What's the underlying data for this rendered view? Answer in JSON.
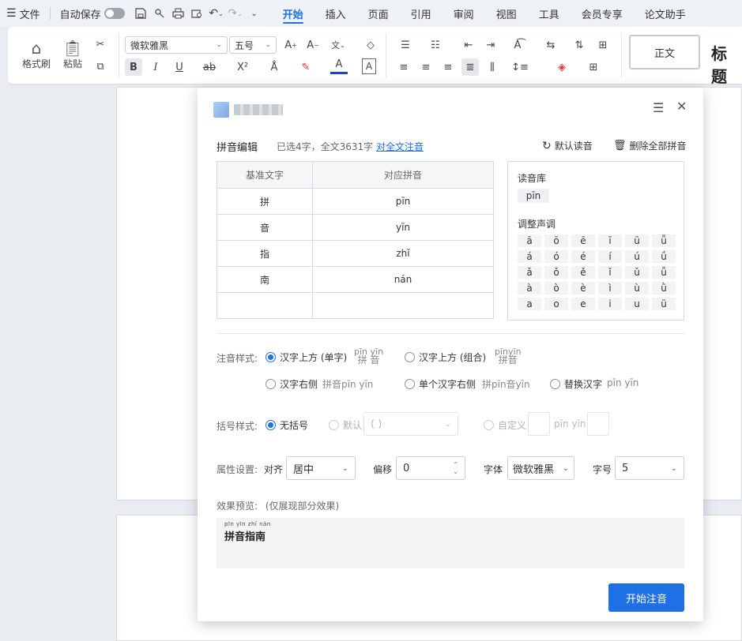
{
  "menubar": {
    "file_label": "文件",
    "autosave_label": "自动保存",
    "tabs": [
      "开始",
      "插入",
      "页面",
      "引用",
      "审阅",
      "视图",
      "工具",
      "会员专享",
      "论文助手"
    ]
  },
  "ribbon": {
    "format_painter": "格式刷",
    "paste": "粘贴",
    "font_name": "微软雅黑",
    "font_size": "五号",
    "bold": "B",
    "italic": "I",
    "underline": "U",
    "strike": "ab",
    "superscript": "X²",
    "font_color": "A",
    "char_border": "A",
    "style_normal": "正文",
    "style_title": "标题"
  },
  "dialog": {
    "section_title": "拼音编辑",
    "selection_info": "已选4字，全文3631字",
    "full_text_link": "对全文注音",
    "default_reading": "默认读音",
    "delete_all": "删除全部拼音",
    "table": {
      "headers": [
        "基准文字",
        "对应拼音"
      ],
      "rows": [
        {
          "char": "拼",
          "pinyin": "pīn"
        },
        {
          "char": "音",
          "pinyin": "yīn"
        },
        {
          "char": "指",
          "pinyin": "zhǐ"
        },
        {
          "char": "南",
          "pinyin": "nán"
        },
        {
          "char": "",
          "pinyin": ""
        }
      ]
    },
    "reading_lib": {
      "title": "读音库",
      "chip": "pīn",
      "tone_title": "调整声调",
      "tones": [
        [
          "ā",
          "ō",
          "ē",
          "ī",
          "ū",
          "ǖ"
        ],
        [
          "á",
          "ó",
          "é",
          "í",
          "ú",
          "ǘ"
        ],
        [
          "ǎ",
          "ǒ",
          "ě",
          "ǐ",
          "ǔ",
          "ǚ"
        ],
        [
          "à",
          "ò",
          "è",
          "ì",
          "ù",
          "ǜ"
        ],
        [
          "a",
          "o",
          "e",
          "i",
          "u",
          "ü"
        ]
      ]
    },
    "annotation": {
      "label": "注音样式:",
      "opt_above_single": "汉字上方 (单字)",
      "sample_above_single_top": "pīn yīn",
      "sample_above_single_bottom": "拼 音",
      "opt_above_group": "汉字上方 (组合)",
      "sample_above_group_top": "pīnyīn",
      "sample_above_group_bottom": "拼音",
      "opt_right": "汉字右侧",
      "sample_right": "拼音pīn yīn",
      "opt_single_right": "单个汉字右侧",
      "sample_single_right": "拼pīn音yīn",
      "opt_replace": "替换汉字",
      "sample_replace": "pīn yīn"
    },
    "bracket": {
      "label": "括号样式:",
      "opt_none": "无括号",
      "opt_default": "默认",
      "default_value": "( )",
      "opt_custom": "自定义",
      "custom_sample": "pīn yīn"
    },
    "props": {
      "label": "属性设置:",
      "align_label": "对齐",
      "align_value": "居中",
      "offset_label": "偏移",
      "offset_value": "0",
      "font_label": "字体",
      "font_value": "微软雅黑",
      "size_label": "字号",
      "size_value": "5"
    },
    "preview": {
      "label": "效果预览:",
      "note": "(仅展现部分效果)",
      "ruby": "pīn yīn zhǐ nán",
      "text": "拼音指南"
    },
    "start_button": "开始注音"
  }
}
